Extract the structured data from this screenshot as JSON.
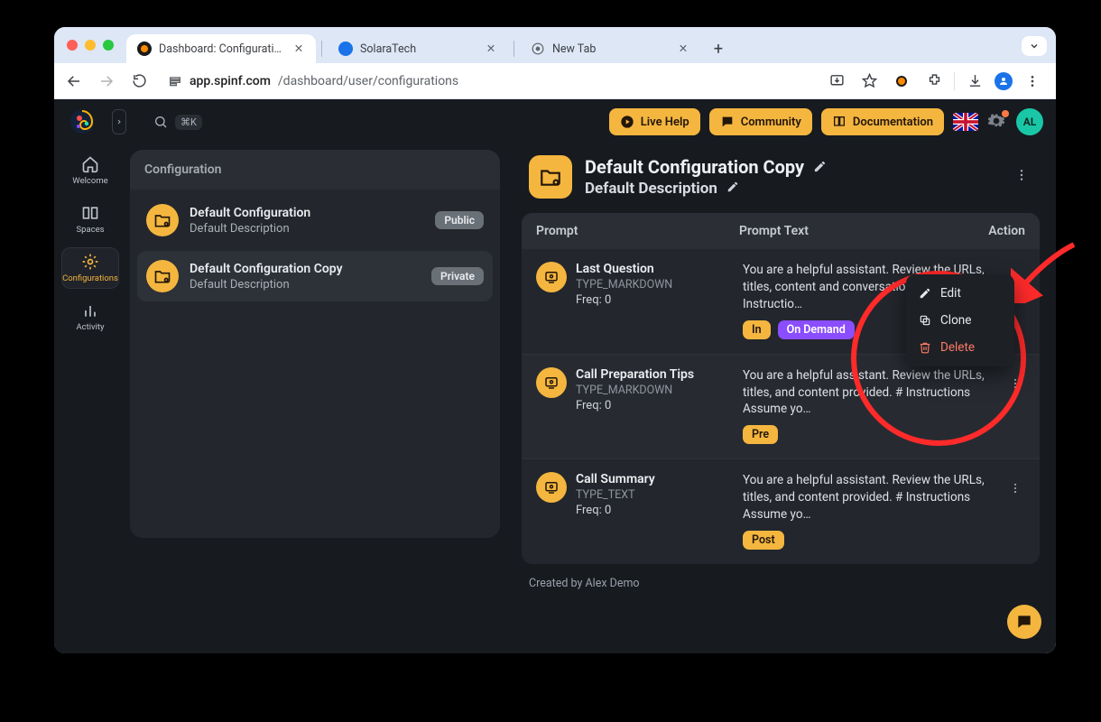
{
  "chrome": {
    "tabs": [
      {
        "title": "Dashboard: Configuration",
        "active": true
      },
      {
        "title": "SolaraTech",
        "active": false
      },
      {
        "title": "New Tab",
        "active": false
      }
    ],
    "url_host": "app.spinf.com",
    "url_path": "/dashboard/user/configurations"
  },
  "topbar": {
    "search_shortcut": "⌘K",
    "live_help": "Live Help",
    "community": "Community",
    "documentation": "Documentation",
    "avatar_initials": "AL"
  },
  "sidebar": {
    "items": [
      {
        "label": "Welcome"
      },
      {
        "label": "Spaces"
      },
      {
        "label": "Configurations"
      },
      {
        "label": "Activity"
      }
    ],
    "active_index": 2
  },
  "configurations": {
    "heading": "Configuration",
    "items": [
      {
        "title": "Default Configuration",
        "description": "Default Description",
        "badge": "Public"
      },
      {
        "title": "Default Configuration Copy",
        "description": "Default Description",
        "badge": "Private"
      }
    ],
    "selected_index": 1
  },
  "detail": {
    "title": "Default Configuration Copy",
    "description": "Default Description",
    "columns": {
      "c1": "Prompt",
      "c2": "Prompt Text",
      "c3": "Action"
    },
    "prompts": [
      {
        "title": "Last Question",
        "type": "TYPE_MARKDOWN",
        "freq": "Freq: 0",
        "text": "You are a helpful assistant. Review the URLs, titles, content and conversation provided. # Instructio…",
        "tags": [
          {
            "label": "In",
            "style": "y"
          },
          {
            "label": "On Demand",
            "style": "p"
          }
        ]
      },
      {
        "title": "Call Preparation Tips",
        "type": "TYPE_MARKDOWN",
        "freq": "Freq: 0",
        "text": "You are a helpful assistant. Review the URLs, titles, and content provided. # Instructions Assume yo…",
        "tags": [
          {
            "label": "Pre",
            "style": "y"
          }
        ]
      },
      {
        "title": "Call Summary",
        "type": "TYPE_TEXT",
        "freq": "Freq: 0",
        "text": "You are a helpful assistant. Review the URLs, titles, and content provided. # Instructions Assume yo…",
        "tags": [
          {
            "label": "Post",
            "style": "y"
          }
        ]
      }
    ],
    "created_by": "Created by Alex Demo"
  },
  "popover": {
    "edit": "Edit",
    "clone": "Clone",
    "delete": "Delete"
  }
}
